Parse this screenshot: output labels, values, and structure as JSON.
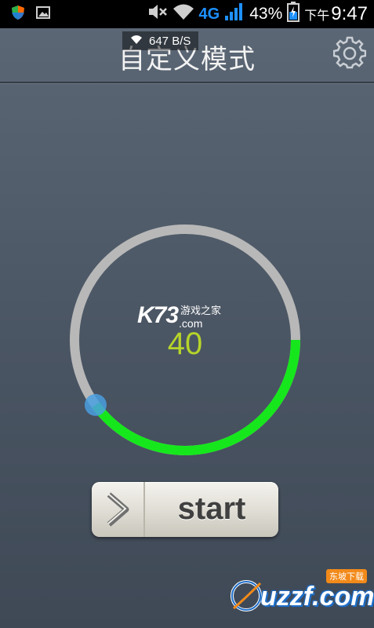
{
  "status_bar": {
    "network_type": "4G",
    "battery_percent": "43%",
    "time_ampm": "下午",
    "time": "9:47"
  },
  "speed_overlay": {
    "text": "647 B/S"
  },
  "header": {
    "title": "自定义模式"
  },
  "dial": {
    "watermark_logo": "K73",
    "watermark_cn": "游戏之家",
    "watermark_com": ".com",
    "value": "40",
    "level_fraction": 0.4,
    "track_color": "#b8b8b8",
    "fill_color": "#16e71c",
    "knob_color": "#4a9fe0"
  },
  "start_button": {
    "label": "start"
  },
  "corner_watermark": {
    "text": "uzzf.com",
    "badge": "东坡下载"
  },
  "colors": {
    "value_text": "#b6d42a",
    "background": "#4a5563"
  }
}
